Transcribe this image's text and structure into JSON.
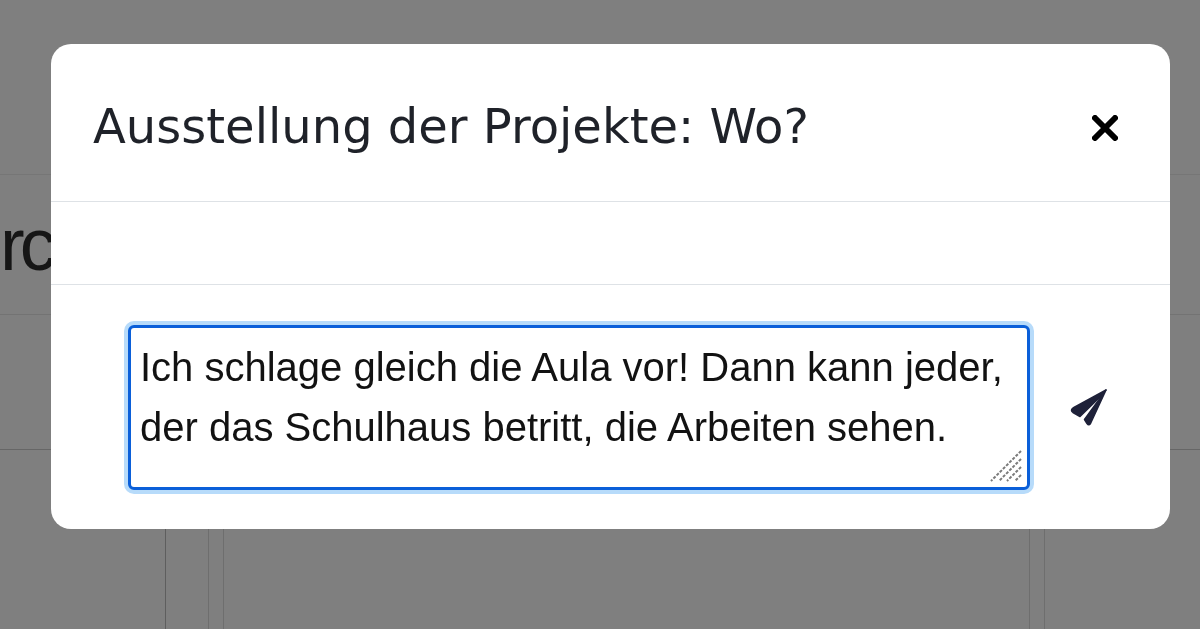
{
  "background_page": {
    "heading": "rc"
  },
  "dialog": {
    "title": "Ausstellung der Projekte: Wo?"
  },
  "composer": {
    "value": "Ich schlage gleich die Aula vor! Dann kann jeder, der das Schulhaus betritt, die Arbeiten sehen.",
    "focused": true
  }
}
